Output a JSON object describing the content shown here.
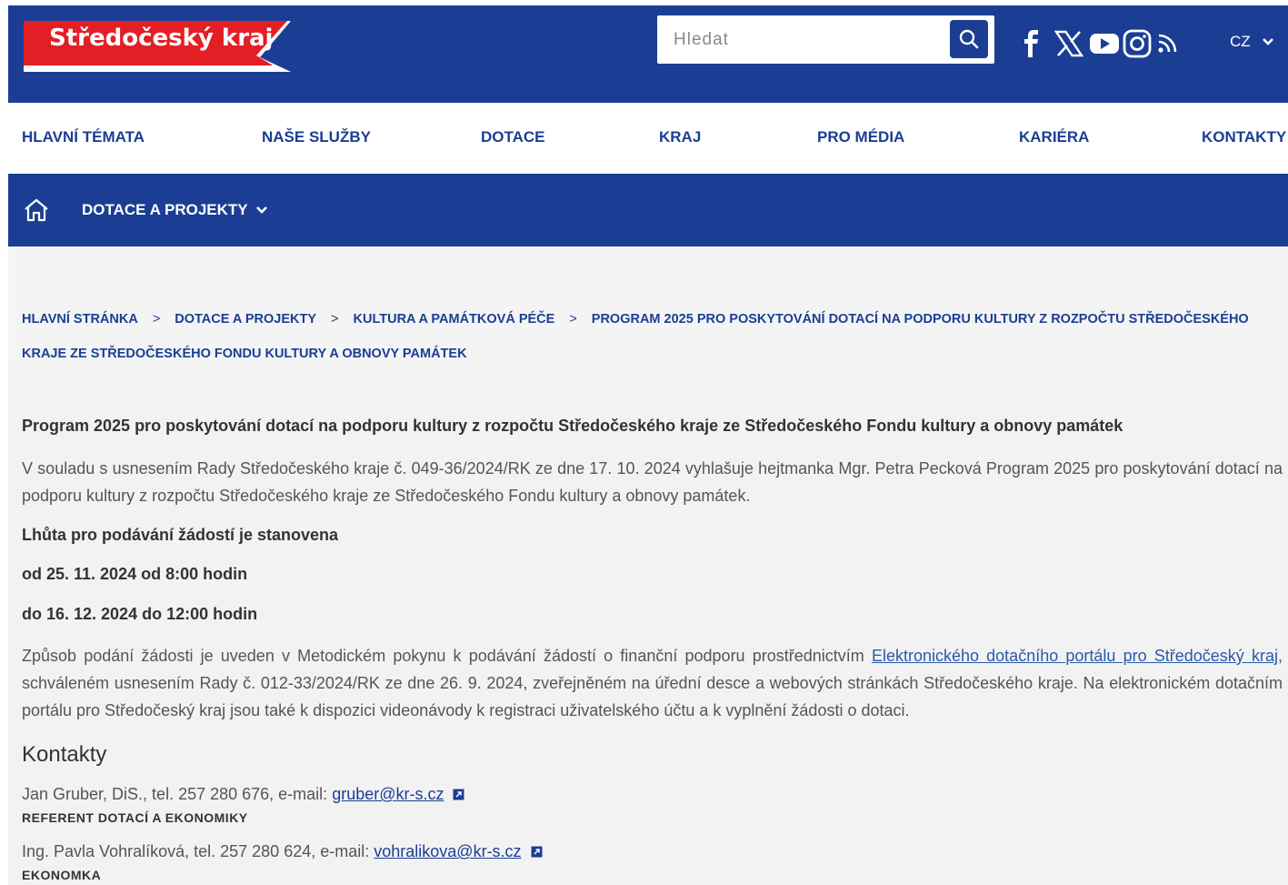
{
  "header": {
    "logo_text": "Středočeský kraj",
    "search_placeholder": "Hledat",
    "lang": "CZ",
    "colors": {
      "primary": "#1b3e94",
      "logo_red": "#e31e24"
    },
    "social_icons": [
      "facebook-icon",
      "x-icon",
      "youtube-icon",
      "instagram-icon",
      "rss-icon"
    ]
  },
  "mainnav": {
    "items": [
      "HLAVNÍ TÉMATA",
      "NAŠE SLUŽBY",
      "DOTACE",
      "KRAJ",
      "PRO MÉDIA",
      "KARIÉRA",
      "KONTAKTY"
    ]
  },
  "subnav": {
    "label": "DOTACE A PROJEKTY"
  },
  "breadcrumb": {
    "items": [
      "HLAVNÍ STRÁNKA",
      "DOTACE A PROJEKTY",
      "KULTURA A PAMÁTKOVÁ PÉČE"
    ],
    "current": "PROGRAM 2025 PRO POSKYTOVÁNÍ DOTACÍ NA PODPORU KULTURY Z ROZPOČTU STŘEDOČESKÉHO KRAJE ZE STŘEDOČESKÉHO FONDU KULTURY A OBNOVY PAMÁTEK",
    "separator": ">"
  },
  "article": {
    "title": "Program 2025 pro poskytování dotací na podporu kultury z rozpočtu Středočeského kraje ze Středočeského Fondu kultury a obnovy památek",
    "intro": "V souladu s usnesením Rady Středočeského kraje č. 049-36/2024/RK ze dne 17. 10. 2024 vyhlašuje hejtmanka Mgr. Petra Pecková Program 2025 pro poskytování dotací na podporu kultury z rozpočtu Středočeského kraje ze Středočeského Fondu kultury a obnovy památek.",
    "deadline_heading": "Lhůta pro podávání žádostí je stanovena",
    "deadline_from": "od 25. 11. 2024 od 8:00 hodin",
    "deadline_to": "do 16. 12. 2024 do 12:00 hodin",
    "method_before": "Způsob podání žádosti je uveden v Metodickém pokynu k podávání žádostí o finanční podporu prostřednictvím ",
    "method_link": "Elektronického dotačního portálu pro Středočeský kraj",
    "method_after": ", schváleném usnesením Rady č. 012-33/2024/RK ze dne 26. 9. 2024, zveřejněném na úřední desce a webových stránkách Středočeského kraje. Na elektronickém dotačním portálu pro Středočeský kraj jsou také k dispozici videonávody k registraci uživatelského účtu a k vyplnění žádosti o dotaci."
  },
  "contacts": {
    "heading": "Kontakty",
    "people": [
      {
        "text": "Jan Gruber, DiS., tel. 257 280 676, e-mail: ",
        "email": "gruber@kr-s.cz",
        "role": "REFERENT DOTACÍ A EKONOMIKY"
      },
      {
        "text": "Ing. Pavla Vohralíková, tel. 257 280 624, e-mail: ",
        "email": "vohralikova@kr-s.cz",
        "role": "EKONOMKA"
      }
    ]
  }
}
